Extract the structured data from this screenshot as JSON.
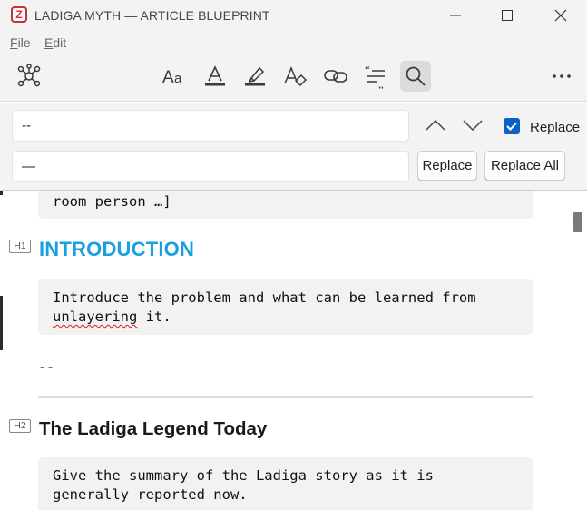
{
  "window": {
    "title": "LADIGA MYTH — ARTICLE BLUEPRINT",
    "app_icon": "Z"
  },
  "menu": {
    "file": "F",
    "file_rest": "ile",
    "edit": "E",
    "edit_rest": "dit"
  },
  "toolbar": {
    "icons": [
      "graph-nodes-icon",
      "font-size-icon",
      "text-color-icon",
      "highlight-icon",
      "clear-format-icon",
      "link-icon",
      "quote-format-icon",
      "search-icon",
      "more-options-icon"
    ],
    "active": "search-icon"
  },
  "find": {
    "search_value": "--",
    "replace_value": "—",
    "replace_checkbox_label": "Replace",
    "replace_checked": true,
    "replace_button": "Replace",
    "replace_all_button": "Replace All"
  },
  "document": {
    "top_block_text": "room person …]",
    "h1_tag": "H1",
    "h1_title": "INTRODUCTION",
    "intro_line1": "Introduce the problem and what can be learned from",
    "intro_misspelled": "unlayering",
    "intro_line2_rest": " it.",
    "plain_text": "--",
    "h2_tag": "H2",
    "h2_title": "The Ladiga Legend Today",
    "legend_line1": "Give the summary of the Ladiga story as it is",
    "legend_line2": "generally reported now."
  },
  "colors": {
    "accent": "#1a9fe0",
    "checkbox": "#0a62c4",
    "spell_error": "#d62020"
  }
}
